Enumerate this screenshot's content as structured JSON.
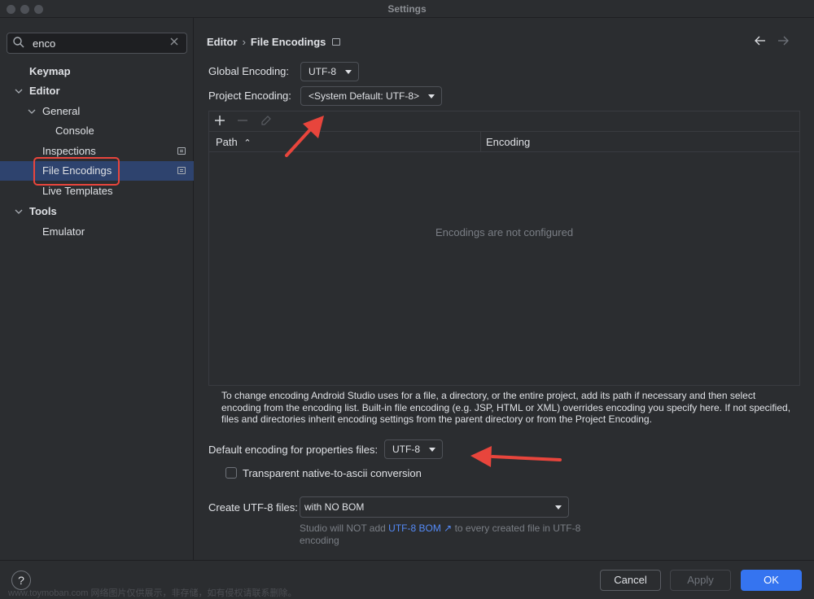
{
  "window": {
    "title": "Settings"
  },
  "sidebar": {
    "search": {
      "value": "enco"
    },
    "items": [
      {
        "label": "Keymap"
      },
      {
        "label": "Editor"
      },
      {
        "label": "General"
      },
      {
        "label": "Console"
      },
      {
        "label": "Inspections"
      },
      {
        "label": "File Encodings"
      },
      {
        "label": "Live Templates"
      },
      {
        "label": "Tools"
      },
      {
        "label": "Emulator"
      }
    ]
  },
  "header": {
    "breadcrumb_parent": "Editor",
    "breadcrumb_separator": "›",
    "breadcrumb_current": "File Encodings"
  },
  "form": {
    "global_encoding_label": "Global Encoding:",
    "global_encoding_value": "UTF-8",
    "project_encoding_label": "Project Encoding:",
    "project_encoding_value": "<System Default: UTF-8>"
  },
  "table": {
    "columns": [
      "Path",
      "Encoding"
    ],
    "sort_indicator": "⌃",
    "empty_text": "Encodings are not configured"
  },
  "help_text": "To change encoding Android Studio uses for a file, a directory, or the entire project, add its path if necessary and then select encoding from the encoding list. Built-in file encoding (e.g. JSP, HTML or XML) overrides encoding you specify here. If not specified, files and directories inherit encoding settings from the parent directory or from the Project Encoding.",
  "properties": {
    "label": "Default encoding for properties files:",
    "value": "UTF-8",
    "checkbox_label": "Transparent native-to-ascii conversion",
    "checkbox_checked": false
  },
  "utf8": {
    "label": "Create UTF-8 files:",
    "value": "with NO BOM",
    "hint_prefix": "Studio will NOT add",
    "hint_link": "UTF-8 BOM ↗",
    "hint_suffix": "to every created file in UTF-8 encoding"
  },
  "footer": {
    "help": "?",
    "cancel": "Cancel",
    "apply": "Apply",
    "ok": "OK"
  },
  "watermark": "www.toymoban.com 网络图片仅供展示，非存储，如有侵权请联系删除。",
  "colors": {
    "background": "#2b2d30",
    "selection": "#2e436e",
    "accent": "#3574f0",
    "link": "#548af7",
    "annotation_red": "#e8453c"
  }
}
